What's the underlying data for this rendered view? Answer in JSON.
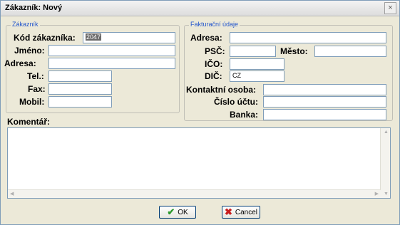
{
  "window": {
    "title": "Zákazník: Nový",
    "close_glyph": "×"
  },
  "customer_group": {
    "legend": "Zákazník",
    "code_label": "Kód zákazníka:",
    "code_value": "2047",
    "name_label": "Jméno:",
    "name_value": "",
    "address_label": "Adresa:",
    "address_value": "",
    "phone_label": "Tel.:",
    "phone_value": "",
    "fax_label": "Fax:",
    "fax_value": "",
    "mobile_label": "Mobil:",
    "mobile_value": ""
  },
  "billing_group": {
    "legend": "Fakturační údaje",
    "address_label": "Adresa:",
    "address_value": "",
    "zip_label": "PSČ:",
    "zip_value": "",
    "city_label": "Město:",
    "city_value": "",
    "ico_label": "IČO:",
    "ico_value": "",
    "dic_label": "DIČ:",
    "dic_value": "CZ",
    "contact_label": "Kontaktní osoba:",
    "contact_value": "",
    "account_label": "Číslo účtu:",
    "account_value": "",
    "bank_label": "Banka:",
    "bank_value": ""
  },
  "comment": {
    "label": "Komentář:",
    "value": ""
  },
  "buttons": {
    "ok_label": "OK",
    "cancel_label": "Cancel"
  },
  "icons": {
    "ok": "checkmark-icon",
    "cancel": "x-cross-icon"
  },
  "colors": {
    "legend": "#2255cc",
    "ok_icon": "#2e9a2e",
    "cancel_icon": "#c81e1e",
    "input_border": "#7f9db9"
  }
}
